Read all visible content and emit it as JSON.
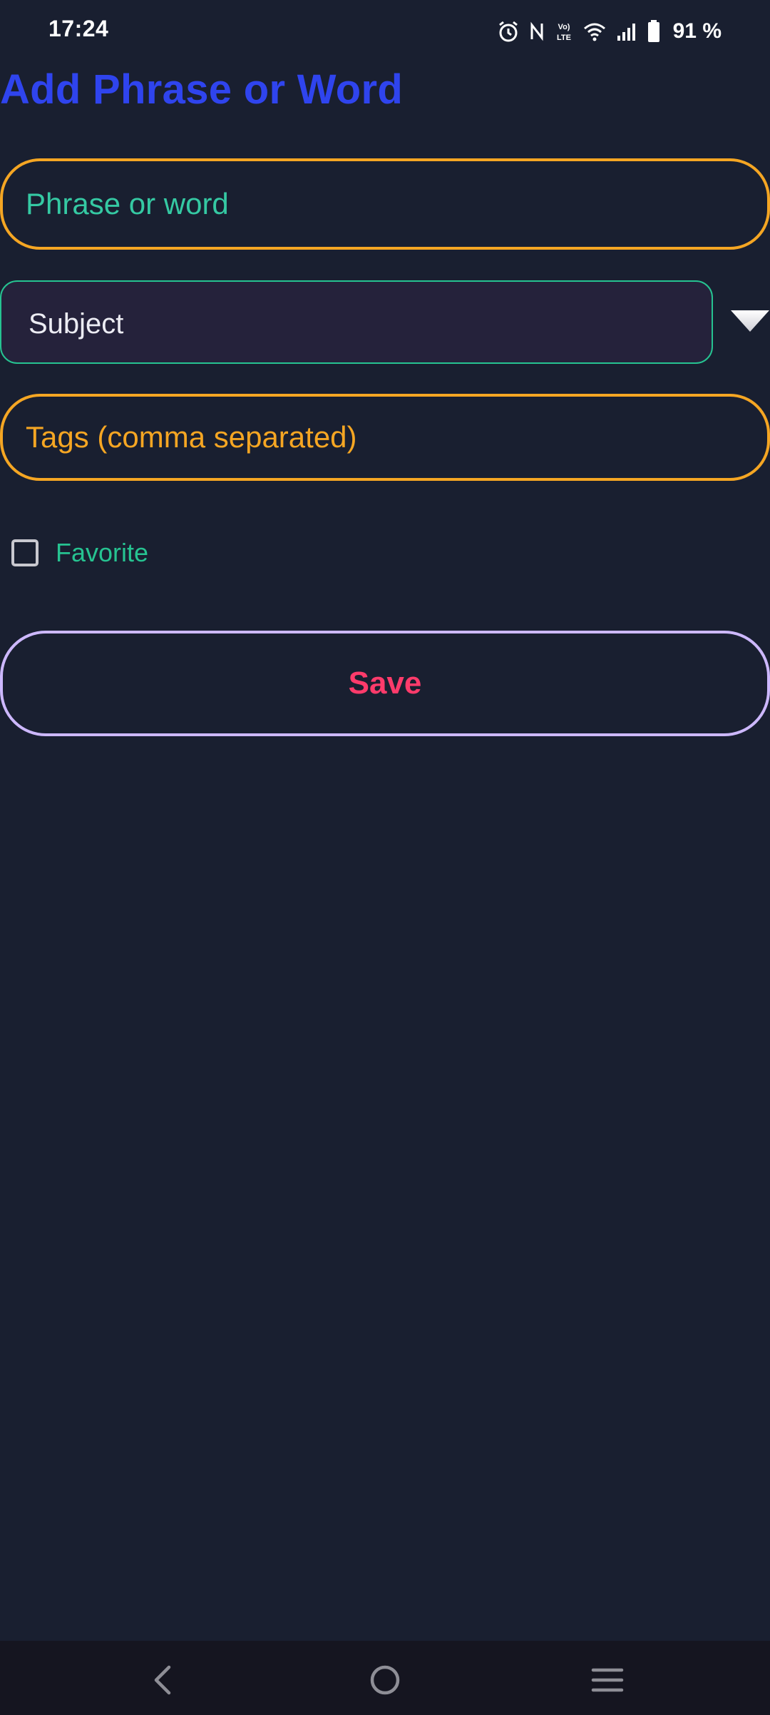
{
  "status_bar": {
    "time": "17:24",
    "battery_text": "91 %",
    "icons": [
      "alarm-icon",
      "nfc-icon",
      "volte-icon",
      "wifi-icon",
      "signal-icon",
      "battery-icon"
    ]
  },
  "page": {
    "title": "Add Phrase or Word"
  },
  "form": {
    "phrase_placeholder": "Phrase or word",
    "subject_selected": "Subject",
    "tags_placeholder": "Tags (comma separated)",
    "favorite_label": "Favorite",
    "favorite_checked": false,
    "save_label": "Save"
  },
  "nav_bar": {
    "icons": [
      "back-icon",
      "home-icon",
      "recents-icon"
    ]
  },
  "colors": {
    "background": "#191f30",
    "title": "#2f44ee",
    "orange_border": "#f5a623",
    "teal": "#26c391",
    "save_text": "#ff3b6b",
    "save_border": "#cdb8ff"
  }
}
